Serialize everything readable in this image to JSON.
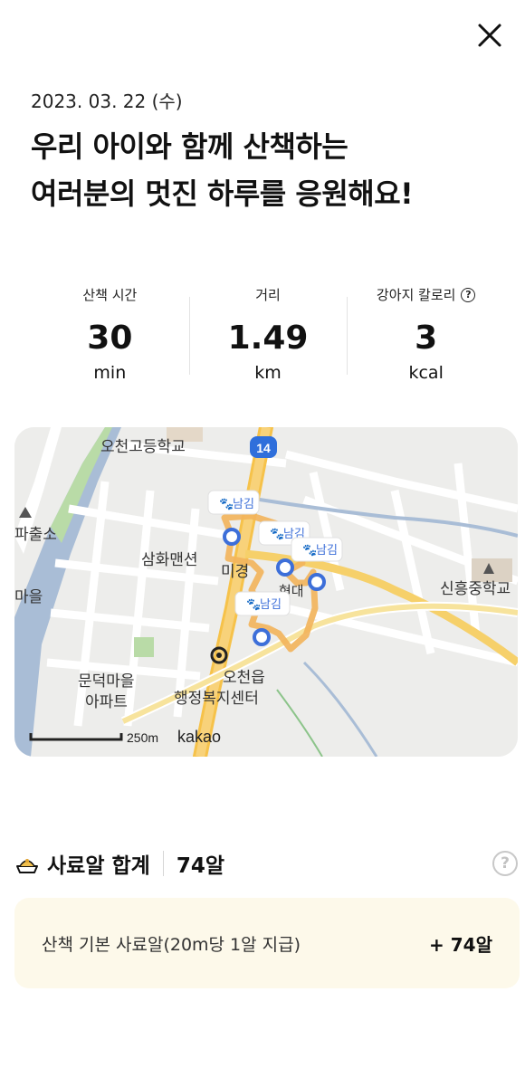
{
  "header": {
    "date": "2023. 03. 22 (수)",
    "headline_line1": "우리 아이와 함께 산책하는",
    "headline_line2": "여러분의 멋진 하루를 응원해요!"
  },
  "stats": [
    {
      "label": "산책 시간",
      "value": "30",
      "unit": "min"
    },
    {
      "label": "거리",
      "value": "1.49",
      "unit": "km"
    },
    {
      "label": "강아지 칼로리",
      "value": "3",
      "unit": "kcal",
      "help_icon": "?"
    }
  ],
  "map": {
    "labels": {
      "school1": "오천고등학교",
      "road_num": "14",
      "police": "파출소",
      "mansion": "삼화맨션",
      "apt_cut1": "미경",
      "apt_cut2": "현대",
      "village1": "문덕마을",
      "village2": "아파트",
      "center1": "오천읍",
      "center2": "행정복지센터",
      "school2": "신흥중학교",
      "left_cut1": "마을",
      "scale": "250m",
      "brand": "kakao"
    },
    "pin_label": "남김",
    "colors": {
      "route": "#f2b45c",
      "pin": "#3d6fd9",
      "road": "#f6c24a",
      "river": "#a9bdd6",
      "green": "#b9dba7"
    }
  },
  "food": {
    "title": "사료알 합계",
    "total": "74알",
    "help_icon": "?",
    "row_label": "산책 기본 사료알(20m당 1알 지급)",
    "row_amount": "+ 74알"
  }
}
